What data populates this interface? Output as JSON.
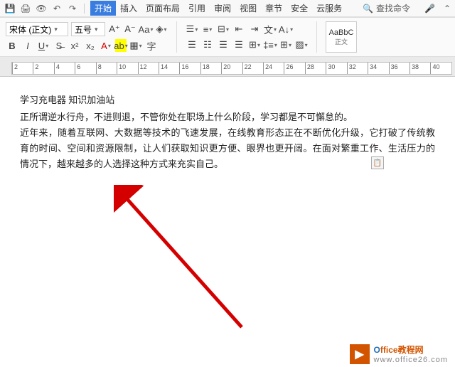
{
  "menu": {
    "items": [
      "开始",
      "插入",
      "页面布局",
      "引用",
      "审阅",
      "视图",
      "章节",
      "安全",
      "云服务"
    ],
    "active_index": 0,
    "search_label": "查找命令"
  },
  "ribbon": {
    "font_name": "宋体 (正文)",
    "font_size": "五号",
    "style": {
      "preview": "AaBbC",
      "name": "正文"
    }
  },
  "ruler": {
    "marks": [
      "2",
      "",
      "2",
      "4",
      "6",
      "8",
      "10",
      "12",
      "14",
      "16",
      "18",
      "20",
      "22",
      "24",
      "26",
      "28",
      "30",
      "32",
      "34",
      "36",
      "38",
      "40"
    ]
  },
  "document": {
    "title": "学习充电器 知识加油站",
    "p1": "正所谓逆水行舟，不进则退，不管你处在职场上什么阶段，学习都是不可懈怠的。",
    "p2": "近年来，随着互联网、大数据等技术的飞速发展，在线教育形态正在不断优化升级，它打破了传统教育的时间、空间和资源限制，让人们获取知识更方便、眼界也更开阔。在面对繁重工作、生活压力的情况下，越来越多的人选择这种方式来充实自己。"
  },
  "watermark": {
    "brand_first": "O",
    "brand_rest": "ffice教程网",
    "url": "www.office26.com"
  }
}
